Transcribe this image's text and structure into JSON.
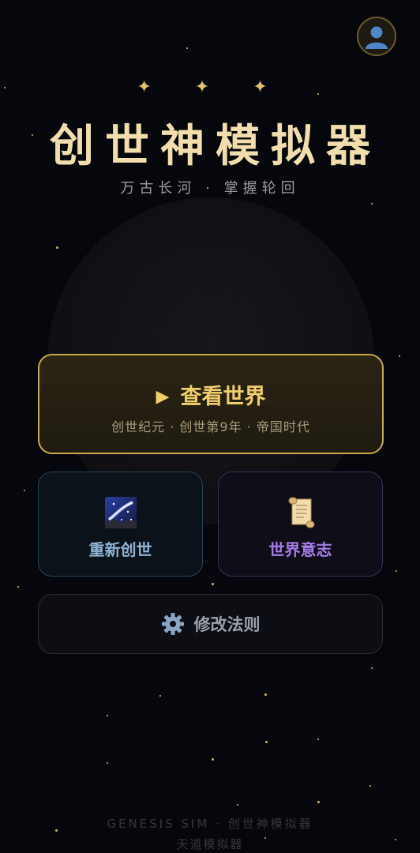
{
  "header": {
    "sparkles": [
      "✦",
      "✦",
      "✦"
    ],
    "title": "创世神模拟器",
    "subtitle": "万古长河 · 掌握轮回",
    "avatar_icon": "user-avatar-icon"
  },
  "primary_action": {
    "play_glyph": "▶",
    "label": "查看世界",
    "info": "创世纪元 · 创世第9年 · 帝国时代"
  },
  "actions": {
    "recreate": {
      "label": "重新创世",
      "icon": "galaxy-icon",
      "color": "#8fb4d6"
    },
    "world_will": {
      "label": "世界意志",
      "icon": "scroll-icon",
      "color": "#a57bea"
    },
    "rules": {
      "label": "修改法则",
      "icon": "gear-icon",
      "color": "#9aa0ab"
    }
  },
  "footer": {
    "line1": "GENESIS SIM · 创世神模拟器",
    "line2": "天道模拟器"
  },
  "colors": {
    "background": "#06070d",
    "gold": "#f0cf6a",
    "title": "#f1deac"
  }
}
